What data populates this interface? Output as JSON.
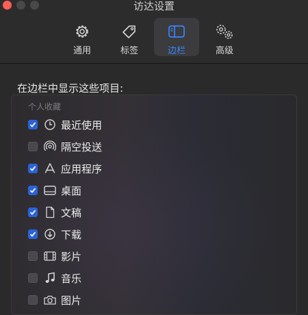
{
  "window": {
    "title": "访达设置"
  },
  "toolbar": {
    "tabs": [
      {
        "label": "通用",
        "icon": "gear-icon",
        "active": false
      },
      {
        "label": "标签",
        "icon": "tag-icon",
        "active": false
      },
      {
        "label": "边栏",
        "icon": "sidebar-icon",
        "active": true
      },
      {
        "label": "高级",
        "icon": "gears-icon",
        "active": false
      }
    ]
  },
  "main": {
    "section_title": "在边栏中显示这些项目:",
    "group_header": "个人收藏",
    "items": [
      {
        "label": "最近使用",
        "checked": true,
        "icon": "clock-icon"
      },
      {
        "label": "隔空投送",
        "checked": false,
        "icon": "airdrop-icon"
      },
      {
        "label": "应用程序",
        "checked": true,
        "icon": "applications-icon"
      },
      {
        "label": "桌面",
        "checked": true,
        "icon": "desktop-icon"
      },
      {
        "label": "文稿",
        "checked": true,
        "icon": "document-icon"
      },
      {
        "label": "下载",
        "checked": true,
        "icon": "download-icon"
      },
      {
        "label": "影片",
        "checked": false,
        "icon": "film-icon"
      },
      {
        "label": "音乐",
        "checked": false,
        "icon": "music-icon"
      },
      {
        "label": "图片",
        "checked": false,
        "icon": "camera-icon"
      }
    ]
  },
  "colors": {
    "accent": "#3a86ff",
    "checkbox_on": "#2a63d6",
    "close": "#fe5f57"
  }
}
